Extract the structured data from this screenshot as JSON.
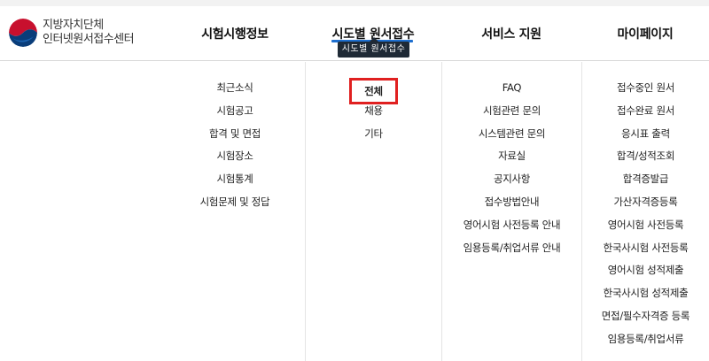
{
  "logo": {
    "line1": "지방자치단체",
    "line2": "인터넷원서접수센터"
  },
  "nav": {
    "menus": [
      {
        "label": "시험시행정보",
        "items": [
          "최근소식",
          "시험공고",
          "합격 및 면접",
          "시험장소",
          "시험통계",
          "시험문제 및 정답"
        ]
      },
      {
        "label": "시도별 원서접수",
        "items": [
          "전체",
          "채용",
          "기타"
        ]
      },
      {
        "label": "서비스 지원",
        "items": [
          "FAQ",
          "시험관련 문의",
          "시스템관련 문의",
          "자료실",
          "공지사항",
          "접수방법안내",
          "영어시험 사전등록 안내",
          "임용등록/취업서류 안내"
        ]
      },
      {
        "label": "마이페이지",
        "items": [
          "접수중인 원서",
          "접수완료 원서",
          "응시표 출력",
          "합격/성적조회",
          "합격증발급",
          "가산자격증등록",
          "영어시험 사전등록",
          "한국사시험 사전등록",
          "영어시험 성적제출",
          "한국사시험 성적제출",
          "면접/필수자격증 등록",
          "임용등록/취업서류"
        ]
      }
    ],
    "tooltip": "시도별 원서접수",
    "active_item": "전체"
  },
  "colors": {
    "accent_blue": "#1e6fcf",
    "highlight_red": "#e02020",
    "tooltip_bg": "#1f2a36"
  }
}
